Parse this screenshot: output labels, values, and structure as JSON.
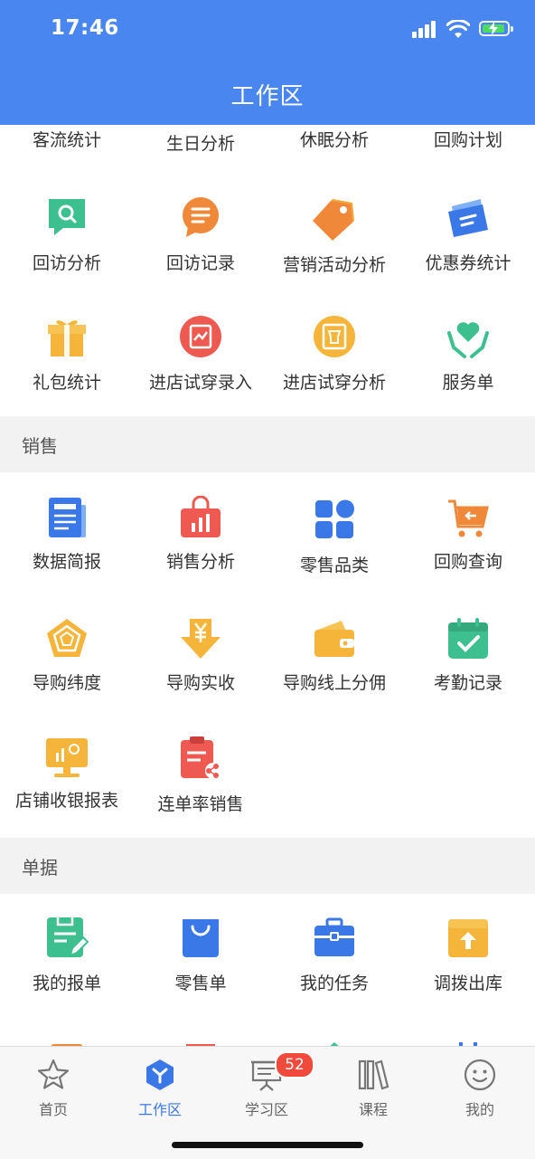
{
  "status_bar": {
    "time": "17:46"
  },
  "header": {
    "title": "工作区"
  },
  "top_partial_row": [
    "客流统计",
    "生日分析",
    "休眠分析",
    "回购计划"
  ],
  "section_member": {
    "rows": [
      [
        {
          "label": "回访分析",
          "icon": "search-chat-icon",
          "color": "#3dbf8f"
        },
        {
          "label": "回访记录",
          "icon": "chat-bubble-icon",
          "color": "#f0883a"
        },
        {
          "label": "营销活动分析",
          "icon": "price-tag-icon",
          "color": "#f0883a"
        },
        {
          "label": "优惠券统计",
          "icon": "coupon-icon",
          "color": "#3b78e7"
        }
      ],
      [
        {
          "label": "礼包统计",
          "icon": "gift-icon",
          "color": "#f5b53a"
        },
        {
          "label": "进店试穿录入",
          "icon": "try-on-entry-icon",
          "color": "#ee5a52"
        },
        {
          "label": "进店试穿分析",
          "icon": "try-on-analysis-icon",
          "color": "#f5b53a"
        },
        {
          "label": "服务单",
          "icon": "heart-hands-icon",
          "color": "#3dbf8f"
        }
      ]
    ]
  },
  "section_sales": {
    "title": "销售",
    "rows": [
      [
        {
          "label": "数据简报",
          "icon": "newspaper-icon",
          "color": "#3b78e7"
        },
        {
          "label": "销售分析",
          "icon": "shopping-bag-chart-icon",
          "color": "#ee5a52"
        },
        {
          "label": "零售品类",
          "icon": "category-grid-icon",
          "color": "#3b78e7"
        },
        {
          "label": "回购查询",
          "icon": "cart-return-icon",
          "color": "#f0883a"
        }
      ],
      [
        {
          "label": "导购纬度",
          "icon": "pentagon-icon",
          "color": "#f5b53a"
        },
        {
          "label": "导购实收",
          "icon": "yuan-down-arrow-icon",
          "color": "#f5b53a"
        },
        {
          "label": "导购线上分佣",
          "icon": "wallet-icon",
          "color": "#f5b53a"
        },
        {
          "label": "考勤记录",
          "icon": "calendar-check-icon",
          "color": "#3dbf8f"
        }
      ],
      [
        {
          "label": "店铺收银报表",
          "icon": "monitor-chart-icon",
          "color": "#f5b53a"
        },
        {
          "label": "连单率销售",
          "icon": "clipboard-share-icon",
          "color": "#ee5a52"
        }
      ]
    ]
  },
  "section_docs": {
    "title": "单据",
    "rows": [
      [
        {
          "label": "我的报单",
          "icon": "report-edit-icon",
          "color": "#3dbf8f"
        },
        {
          "label": "零售单",
          "icon": "shopping-bag-icon",
          "color": "#3b78e7"
        },
        {
          "label": "我的任务",
          "icon": "briefcase-icon",
          "color": "#3b78e7"
        },
        {
          "label": "调拨出库",
          "icon": "box-upload-icon",
          "color": "#f5b53a"
        }
      ]
    ]
  },
  "tabbar": {
    "items": [
      {
        "label": "首页",
        "icon": "star-icon",
        "active": false
      },
      {
        "label": "工作区",
        "icon": "hexagon-y-icon",
        "active": true
      },
      {
        "label": "学习区",
        "icon": "presentation-board-icon",
        "active": false
      },
      {
        "label": "课程",
        "icon": "books-icon",
        "active": false
      },
      {
        "label": "我的",
        "icon": "smiley-face-icon",
        "active": false
      }
    ],
    "badge": "52"
  }
}
